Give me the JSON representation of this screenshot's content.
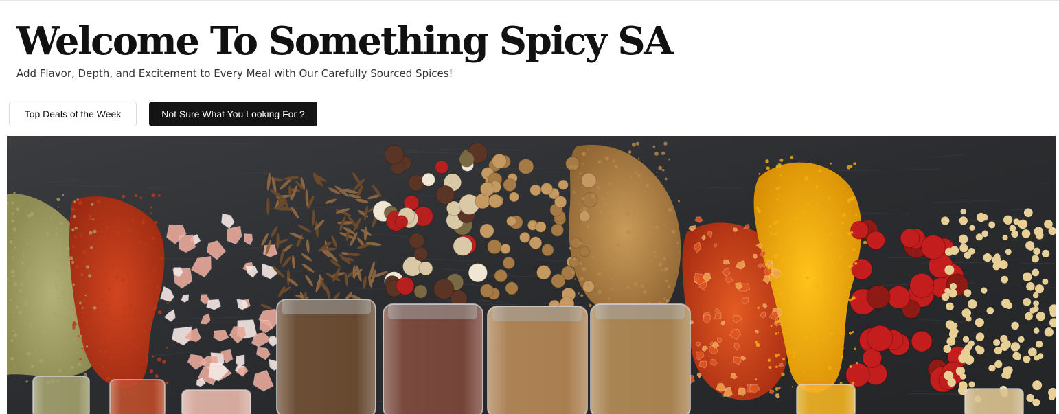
{
  "hero": {
    "title": "Welcome To Something Spicy SA",
    "subtitle": "Add Flavor, Depth, and Excitement to Every Meal with Our Carefully Sourced Spices!"
  },
  "buttons": {
    "top_deals_label": "Top Deals of the Week",
    "not_sure_label": "Not Sure What You Looking For ?"
  },
  "banner": {
    "subject": "spices-on-slate-photo",
    "colors": {
      "slate": "#2c2e31",
      "green_powder": "#a7a46a",
      "paprika": "#c13b18",
      "pink_salt": "#e9a99a",
      "cumin": "#6b4a2c",
      "peppercorn_red": "#b81f1f",
      "coriander": "#c49a62",
      "spice_blend": "#b98a4b",
      "chili_flakes": "#d2451b",
      "turmeric": "#f2b20f",
      "mustard_seed": "#e8cf95",
      "glass": "#cfd4d6"
    }
  }
}
